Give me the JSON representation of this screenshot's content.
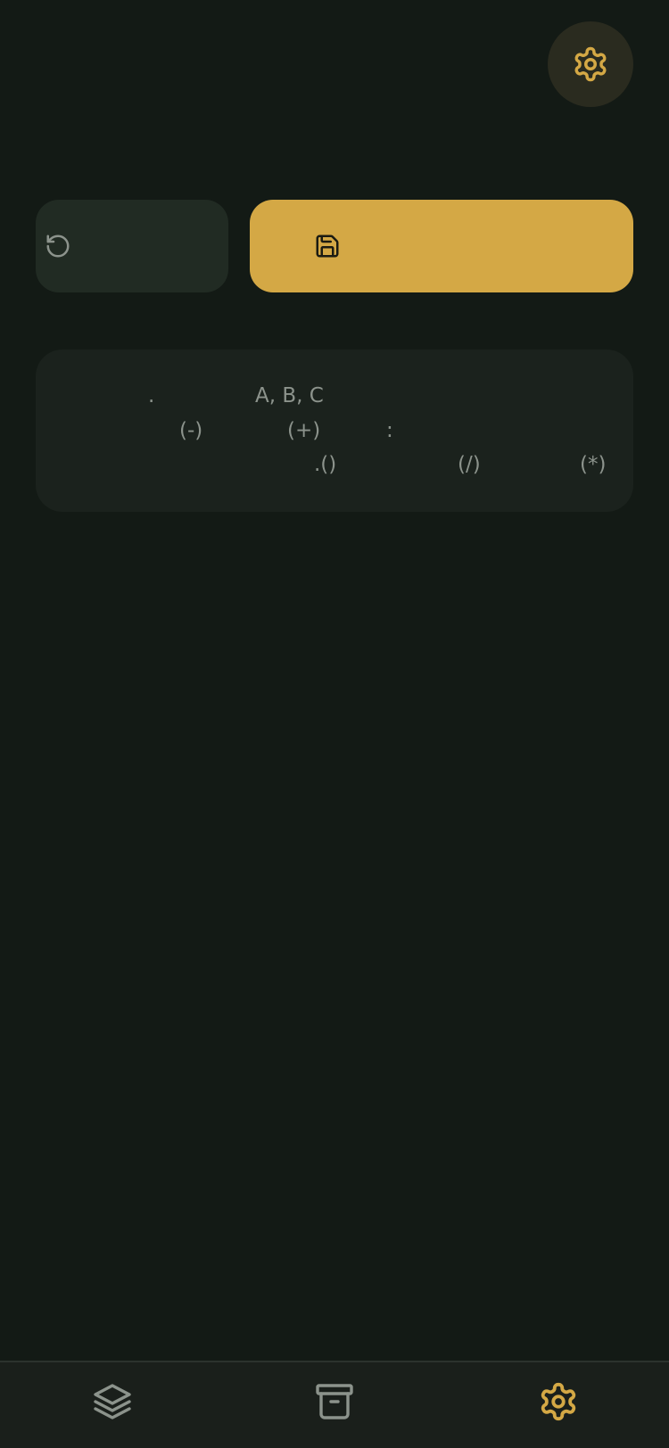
{
  "colors": {
    "background": "#131a15",
    "accent": "#d4a845",
    "muted_icon": "#8c938c"
  },
  "header": {
    "settings_icon": "gear-icon"
  },
  "actions": {
    "reset_icon": "rotate-ccw-icon",
    "save_icon": "save-icon"
  },
  "info_card": {
    "line1": [
      ".",
      "A, B, C"
    ],
    "line2": [
      "(-)",
      "(+)",
      ":"
    ],
    "line3": [
      ".()",
      "(/)",
      "(*)"
    ]
  },
  "bottom_nav": {
    "items": [
      {
        "icon": "layers-icon",
        "active": false
      },
      {
        "icon": "archive-icon",
        "active": false
      },
      {
        "icon": "gear-icon",
        "active": true
      }
    ]
  }
}
